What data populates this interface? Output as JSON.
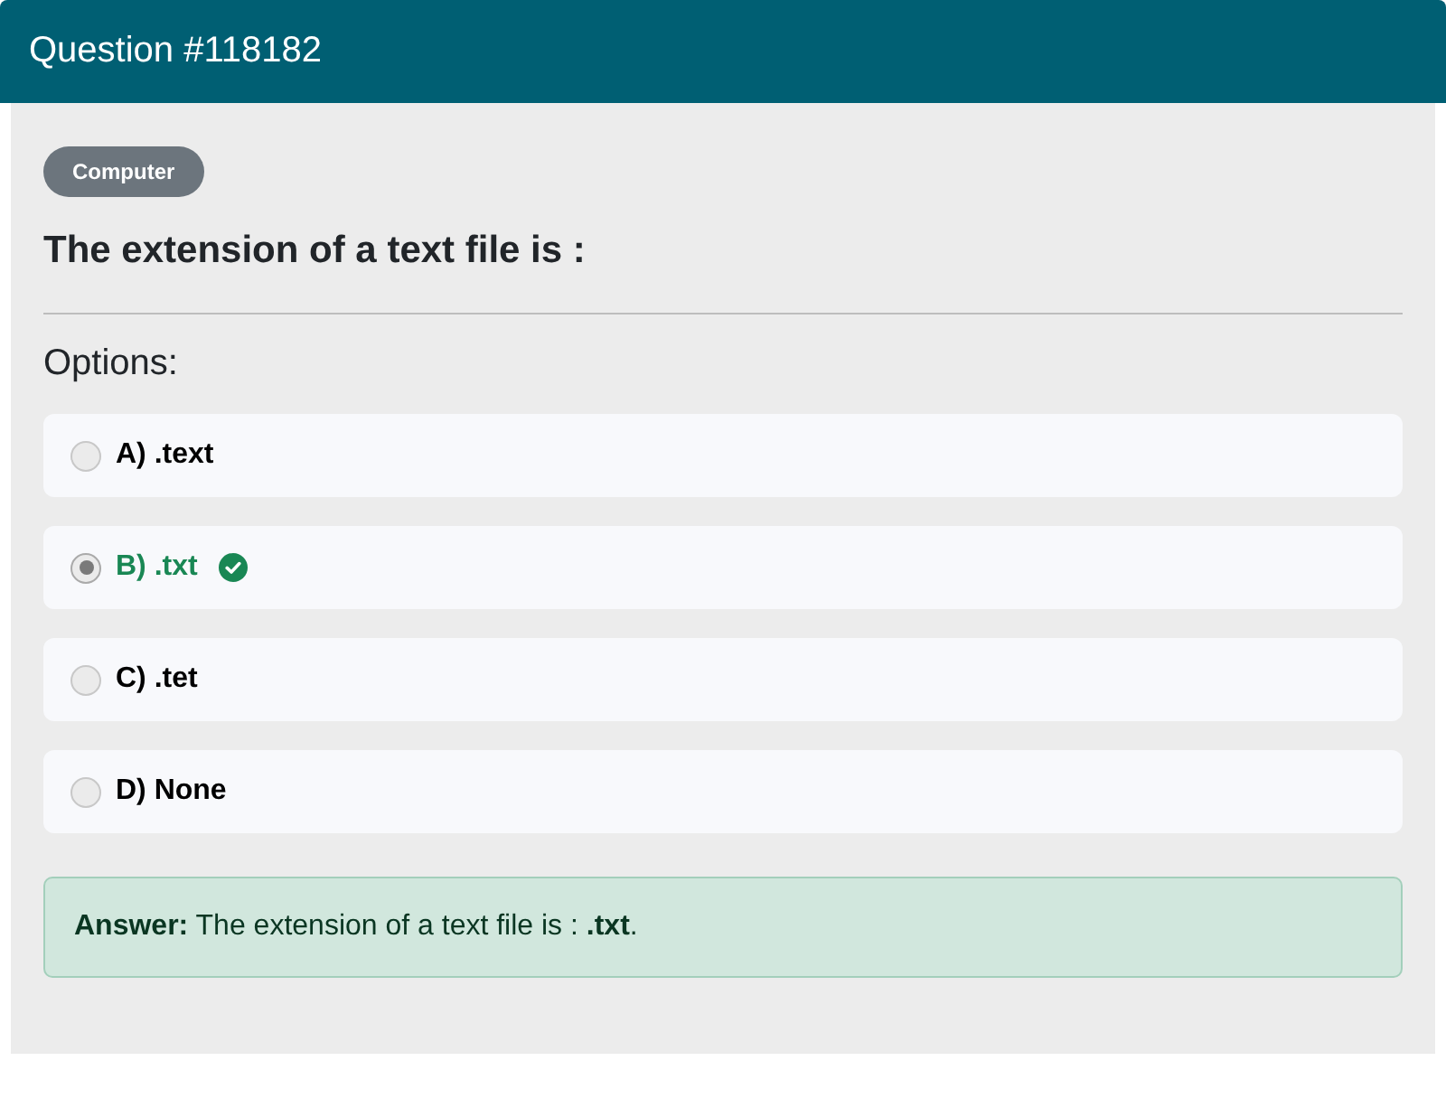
{
  "header": {
    "title": "Question #118182"
  },
  "category": "Computer",
  "question": "The extension of a text file is :",
  "options_label": "Options:",
  "options": [
    {
      "label": "A) .text",
      "selected": false,
      "correct": false
    },
    {
      "label": "B) .txt",
      "selected": true,
      "correct": true
    },
    {
      "label": "C) .tet",
      "selected": false,
      "correct": false
    },
    {
      "label": "D) None",
      "selected": false,
      "correct": false
    }
  ],
  "answer": "**Answer:** The extension of a text file is : **.txt**."
}
